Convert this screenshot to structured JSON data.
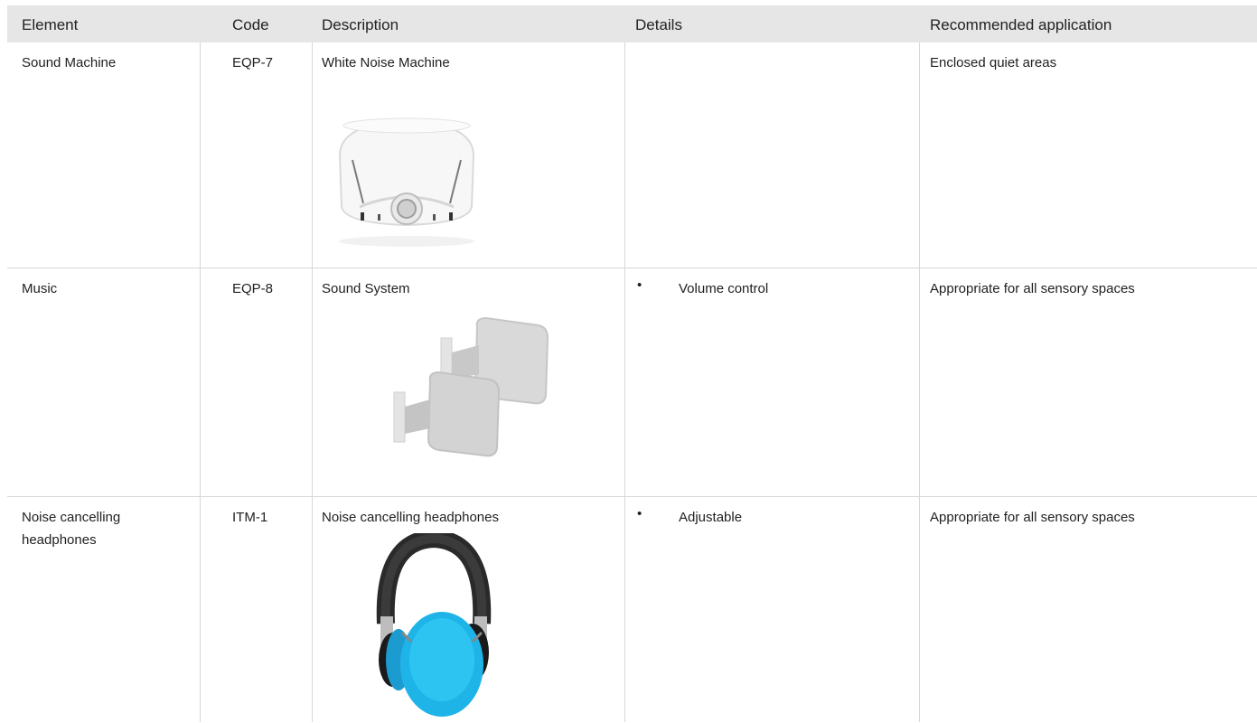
{
  "header": {
    "element": "Element",
    "code": "Code",
    "description": "Description",
    "details": "Details",
    "application": "Recommended application"
  },
  "rows": [
    {
      "element": "Sound Machine",
      "code": "EQP-7",
      "description": "White Noise Machine",
      "details": "",
      "application": "Enclosed quiet areas",
      "image": "white-noise-machine"
    },
    {
      "element": "Music",
      "code": "EQP-8",
      "description": "Sound System",
      "details_bullet": "•",
      "details": "Volume control",
      "application": "Appropriate for all sensory spaces",
      "image": "speaker-pair"
    },
    {
      "element": "Noise cancelling headphones",
      "code": "ITM-1",
      "description": "Noise cancelling headphones",
      "details_bullet": "•",
      "details": "Adjustable",
      "application": "Appropriate for all sensory spaces",
      "image": "headphones"
    }
  ],
  "colors": {
    "header_bg": "#e6e6e6",
    "border": "#d7d7d7",
    "headphone_blue": "#1fb4e8"
  }
}
